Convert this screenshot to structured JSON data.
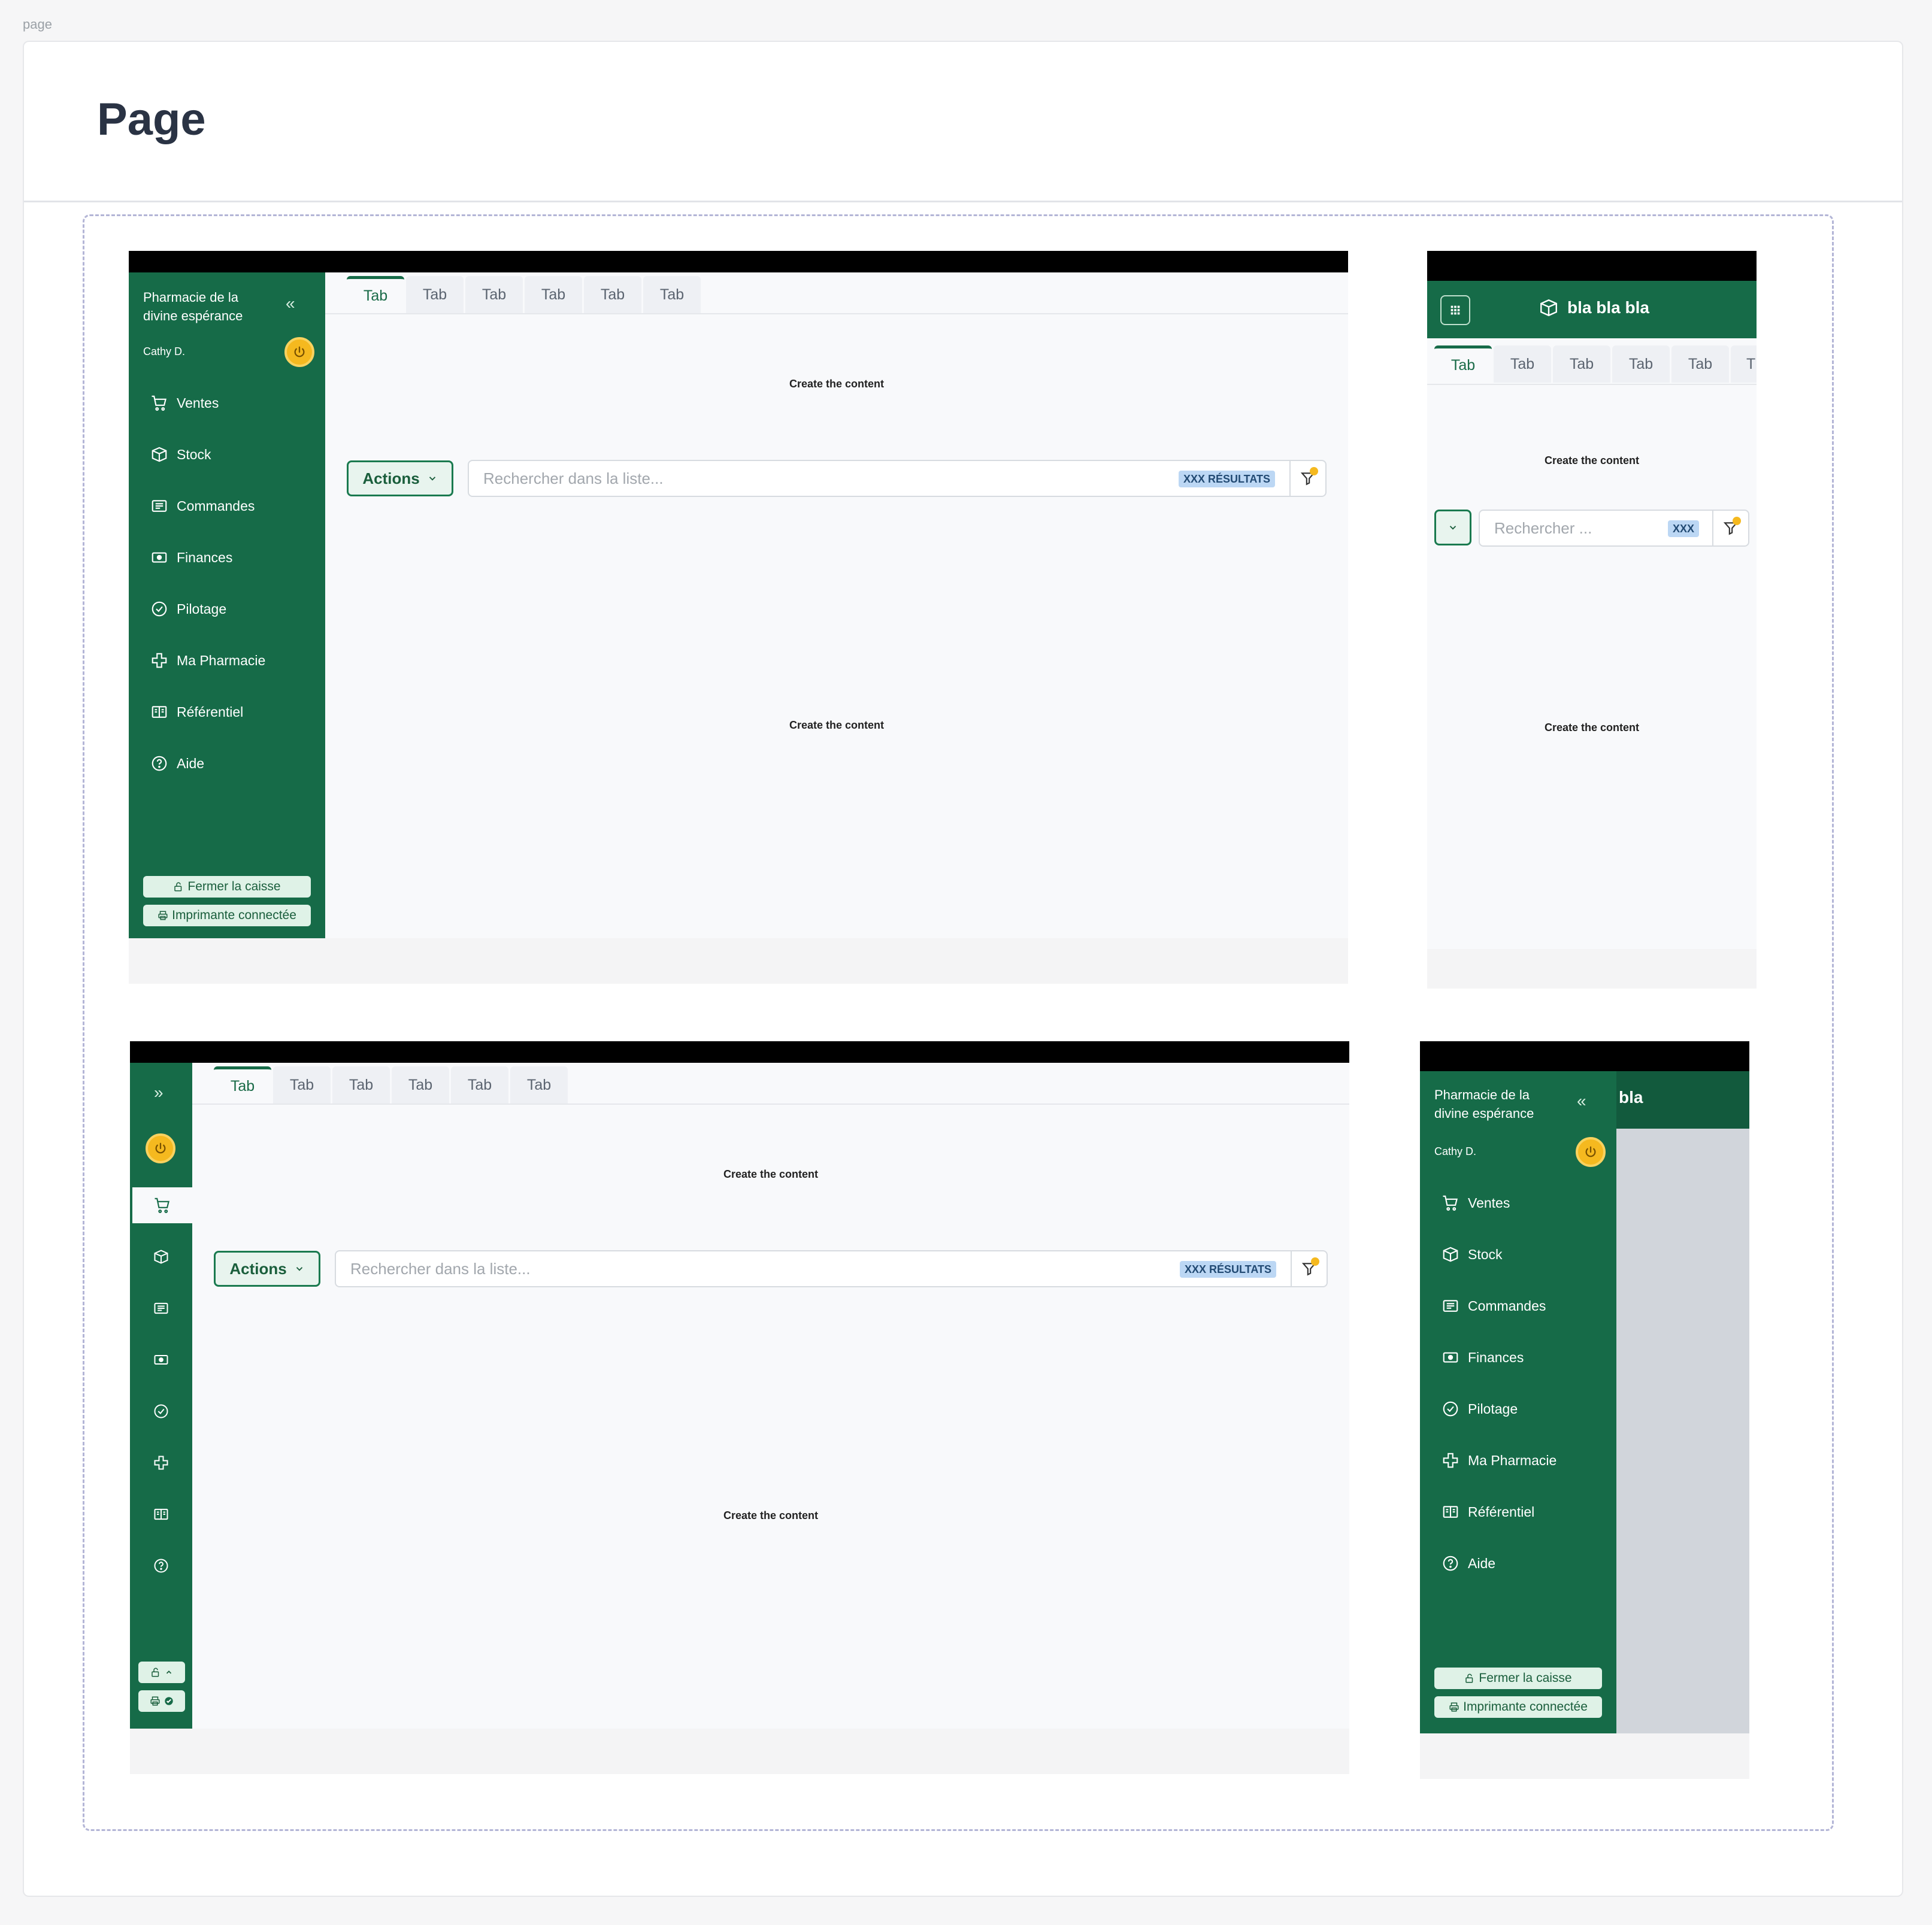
{
  "page_label": "page",
  "page_title": "Page",
  "tab_label": "Tab",
  "partial_tab_label": "T",
  "content_placeholder": "Create the content",
  "sidebar": {
    "pharmacy_line1": "Pharmacie de la",
    "pharmacy_line2": "divine espérance",
    "user": "Cathy D.",
    "collapse_glyph": "«",
    "expand_glyph": "»",
    "items": [
      {
        "label": "Ventes",
        "icon": "cart-icon"
      },
      {
        "label": "Stock",
        "icon": "box-icon"
      },
      {
        "label": "Commandes",
        "icon": "orders-icon"
      },
      {
        "label": "Finances",
        "icon": "cash-icon"
      },
      {
        "label": "Pilotage",
        "icon": "gauge-icon"
      },
      {
        "label": "Ma Pharmacie",
        "icon": "cross-icon"
      },
      {
        "label": "Référentiel",
        "icon": "book-icon"
      },
      {
        "label": "Aide",
        "icon": "help-icon"
      }
    ],
    "close_register": "Fermer la caisse",
    "printer": "Imprimante connectée"
  },
  "toolbar": {
    "actions_label": "Actions",
    "search_placeholder": "Rechercher dans la liste...",
    "results_badge": "XXX RÉSULTATS",
    "mobile_search_placeholder": "Rechercher ...",
    "mobile_results_badge": "XXX"
  },
  "mobile": {
    "title": "bla bla bla",
    "partial_title": "bla"
  },
  "colors": {
    "brand_green": "#166b48",
    "accent_yellow": "#f5b91f",
    "badge_blue": "#bcd7f4"
  }
}
